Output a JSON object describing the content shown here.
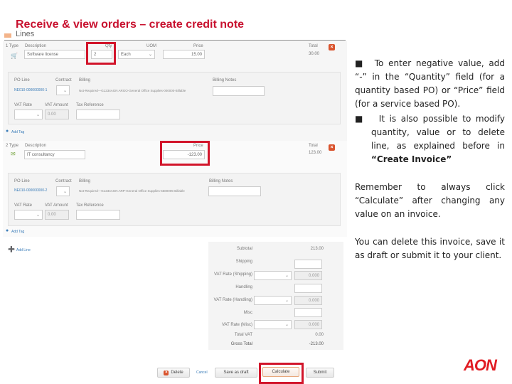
{
  "slide": {
    "title": "Receive & view orders – create credit note",
    "logo": "AON"
  },
  "lines_section": {
    "header": "Lines",
    "line1": {
      "number_type_label": "1 Type",
      "type_icon": "cart-icon",
      "description_label": "Description",
      "description_value": "Software license",
      "qty_label": "Qty",
      "qty_value": "2",
      "uom_label": "UOM",
      "uom_value": "Each",
      "price_label": "Price",
      "price_value": "15.00",
      "total_label": "Total",
      "total_value": "30.00",
      "po_line_label": "PO Line",
      "po_line_value": "NE010-000000000-1",
      "contract_label": "Contract",
      "billing_label": "Billing",
      "billing_value": "Not-Required—G1234AGN ARGO-General Office Supplies-000000-Billable",
      "billing_notes_label": "Billing Notes",
      "billing_notes_value": "",
      "vat_rate_label": "VAT Rate",
      "vat_amount_label": "VAT Amount",
      "vat_amount_value": "0.00",
      "tax_reference_label": "Tax Reference",
      "tax_reference_value": "",
      "add_tag_label": "Add Tag"
    },
    "line2": {
      "number_type_label": "2 Type",
      "type_icon": "service-icon",
      "description_label": "Description",
      "description_value": "IT consultancy",
      "price_label": "Price",
      "price_value": "-123.00",
      "total_label": "Total",
      "total_value": "123.00",
      "po_line_label": "PO Line",
      "po_line_value": "NE010-000000000-2",
      "contract_label": "Contract",
      "billing_label": "Billing",
      "billing_value": "Not-Required—G1234AGN ARP-General Office Supplies-6580005-Billable",
      "billing_notes_label": "Billing Notes",
      "billing_notes_value": "",
      "vat_rate_label": "VAT Rate",
      "vat_amount_label": "VAT Amount",
      "vat_amount_value": "0.00",
      "tax_reference_label": "Tax Reference",
      "tax_reference_value": "",
      "add_tag_label": "Add Tag"
    },
    "add_line_label": "Add Line"
  },
  "totals": {
    "subtotal_label": "Subtotal",
    "subtotal_value": "213.00",
    "shipping_label": "Shipping",
    "vat_shipping_label": "VAT Rate (Shipping)",
    "vat_shipping_value": "0.000",
    "handling_label": "Handling",
    "vat_handling_label": "VAT Rate (Handling)",
    "vat_handling_value": "0.000",
    "misc_label": "Misc",
    "vat_misc_label": "VAT Rate (Misc)",
    "vat_misc_value": "0.000",
    "total_vat_label": "Total VAT",
    "total_vat_value": "0.00",
    "gross_total_label": "Gross Total",
    "gross_total_value": "-213.00"
  },
  "actions": {
    "delete": "Delete",
    "cancel": "Cancel",
    "save_draft": "Save as draft",
    "calculate": "Calculate",
    "submit": "Submit"
  },
  "notes": {
    "bullet1": "To enter negative value, add “-” in the “Quantity” field (for a quantity based PO) or “Price” field (for a service based PO).",
    "bullet2_prefix": "It is also possible to modify quantity,  value or to delete line, as explained before in ",
    "bullet2_bold": "“Create Invoice”",
    "reminder": "Remember to always click “Calculate” after changing any value on an invoice.",
    "closing": "You can delete this invoice, save it as draft or submit it to your client."
  }
}
